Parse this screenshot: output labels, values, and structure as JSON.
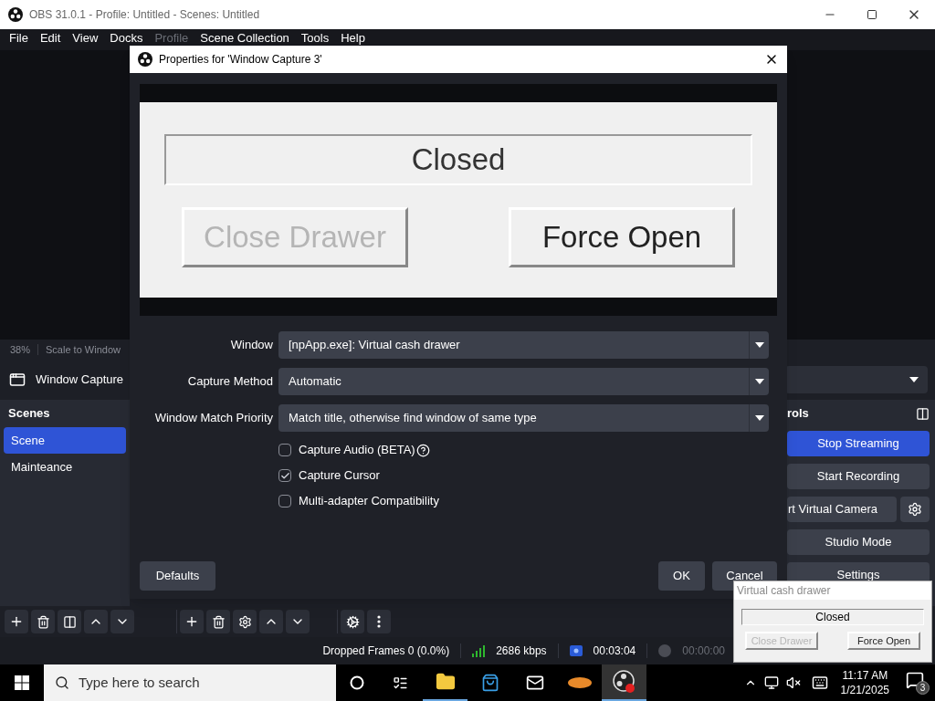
{
  "window": {
    "title": "OBS 31.0.1 - Profile: Untitled - Scenes: Untitled"
  },
  "menu": [
    {
      "label": "File",
      "disabled": false
    },
    {
      "label": "Edit",
      "disabled": false
    },
    {
      "label": "View",
      "disabled": false
    },
    {
      "label": "Docks",
      "disabled": false
    },
    {
      "label": "Profile",
      "disabled": true
    },
    {
      "label": "Scene Collection",
      "disabled": false
    },
    {
      "label": "Tools",
      "disabled": false
    },
    {
      "label": "Help",
      "disabled": false
    }
  ],
  "preview_bar": {
    "zoom": "38%",
    "scale_mode": "Scale to Window"
  },
  "source_bar": {
    "source": "Window Capture"
  },
  "scenes_dock": {
    "title": "Scenes",
    "items": [
      {
        "label": "Scene",
        "selected": true
      },
      {
        "label": "Mainteance",
        "selected": false
      }
    ]
  },
  "controls_dock": {
    "title": "rols",
    "buttons": [
      {
        "label": "Stop Streaming",
        "on": true,
        "kind": "plain"
      },
      {
        "label": "Start Recording",
        "on": false,
        "kind": "plain"
      },
      {
        "label": "rt Virtual Camera",
        "on": false,
        "kind": "with-settings"
      },
      {
        "label": "Studio Mode",
        "on": false,
        "kind": "plain"
      },
      {
        "label": "Settings",
        "on": false,
        "kind": "plain"
      }
    ]
  },
  "status_bar": {
    "dropped_frames": "Dropped Frames 0 (0.0%)",
    "bitrate": "2686 kbps",
    "stream_time": "00:03:04",
    "record_time": "00:00:00"
  },
  "dialog": {
    "title": "Properties for 'Window Capture 3'",
    "preview": {
      "status": "Closed",
      "buttons": [
        {
          "label": "Close Drawer",
          "disabled": true
        },
        {
          "label": "Force Open",
          "disabled": false
        }
      ]
    },
    "fields": [
      {
        "label": "Window",
        "value": "[npApp.exe]: Virtual cash drawer"
      },
      {
        "label": "Capture Method",
        "value": "Automatic"
      },
      {
        "label": "Window Match Priority",
        "value": "Match title, otherwise find window of same type"
      }
    ],
    "checkboxes": [
      {
        "label": "Capture Audio (BETA)",
        "checked": false,
        "help": true
      },
      {
        "label": "Capture Cursor",
        "checked": true,
        "help": false
      },
      {
        "label": "Multi-adapter Compatibility",
        "checked": false,
        "help": false
      }
    ],
    "buttons": {
      "defaults": "Defaults",
      "ok": "OK",
      "cancel": "Cancel"
    }
  },
  "popup": {
    "title": "Virtual cash drawer",
    "status": "Closed",
    "buttons": [
      {
        "label": "Close Drawer",
        "disabled": true
      },
      {
        "label": "Force Open",
        "disabled": false
      }
    ]
  },
  "taskbar": {
    "search_placeholder": "Type here to search",
    "time": "11:17 AM",
    "date": "1/21/2025",
    "notifications": "3"
  }
}
